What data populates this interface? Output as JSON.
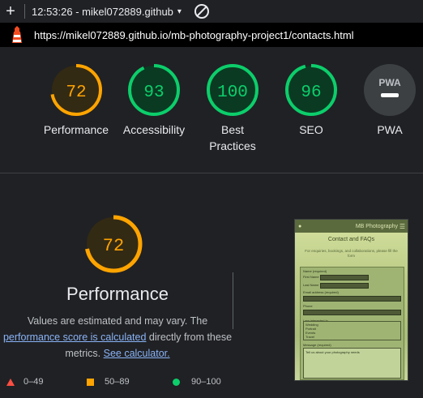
{
  "topbar": {
    "report_title": "12:53:26 - mikel072889.github",
    "plus_icon": "+",
    "caret_icon": "▾"
  },
  "urlbar": {
    "url": "https://mikel072889.github.io/mb-photography-project1/contacts.html"
  },
  "categories": [
    {
      "label": "Performance",
      "score": "72",
      "fraction": 0.72,
      "status": "average"
    },
    {
      "label": "Accessibility",
      "score": "93",
      "fraction": 0.93,
      "status": "pass"
    },
    {
      "label": "Best Practices",
      "score": "100",
      "fraction": 1.0,
      "status": "pass"
    },
    {
      "label": "SEO",
      "score": "96",
      "fraction": 0.96,
      "status": "pass"
    },
    {
      "label": "PWA",
      "score": "PWA",
      "status": "na"
    }
  ],
  "performance": {
    "score": "72",
    "fraction": 0.72,
    "title": "Performance",
    "desc_1": "Values are estimated and may vary. The",
    "link_1": "performance score is calculated",
    "desc_2": "directly from these",
    "desc_3": "metrics.",
    "link_2": "See calculator."
  },
  "legend": {
    "fail": "0–49",
    "average": "50–89",
    "pass": "90–100"
  },
  "screenshot": {
    "site_title": "MB Photography",
    "heading": "Contact and FAQs",
    "intro": "For enquiries, bookings, and collaborations, please fill the form",
    "name_label": "Name (required)",
    "first_name": "First Name",
    "last_name": "Last Name",
    "email_label": "Email address (required)",
    "phone_label": "Phone",
    "interest_label": "I am interested in",
    "options": [
      "Wedding",
      "Portrait",
      "Events",
      "Travel"
    ],
    "message_label": "Message (required)",
    "message_placeholder": "Tell us about your photography needs"
  },
  "colors": {
    "average": "#ffa400",
    "pass": "#0cce6b",
    "fail": "#ff4e42",
    "average_bg": "#332a14",
    "pass_bg": "#0a3a22",
    "text_average": "#ffa400",
    "text_pass": "#0cce6b"
  }
}
